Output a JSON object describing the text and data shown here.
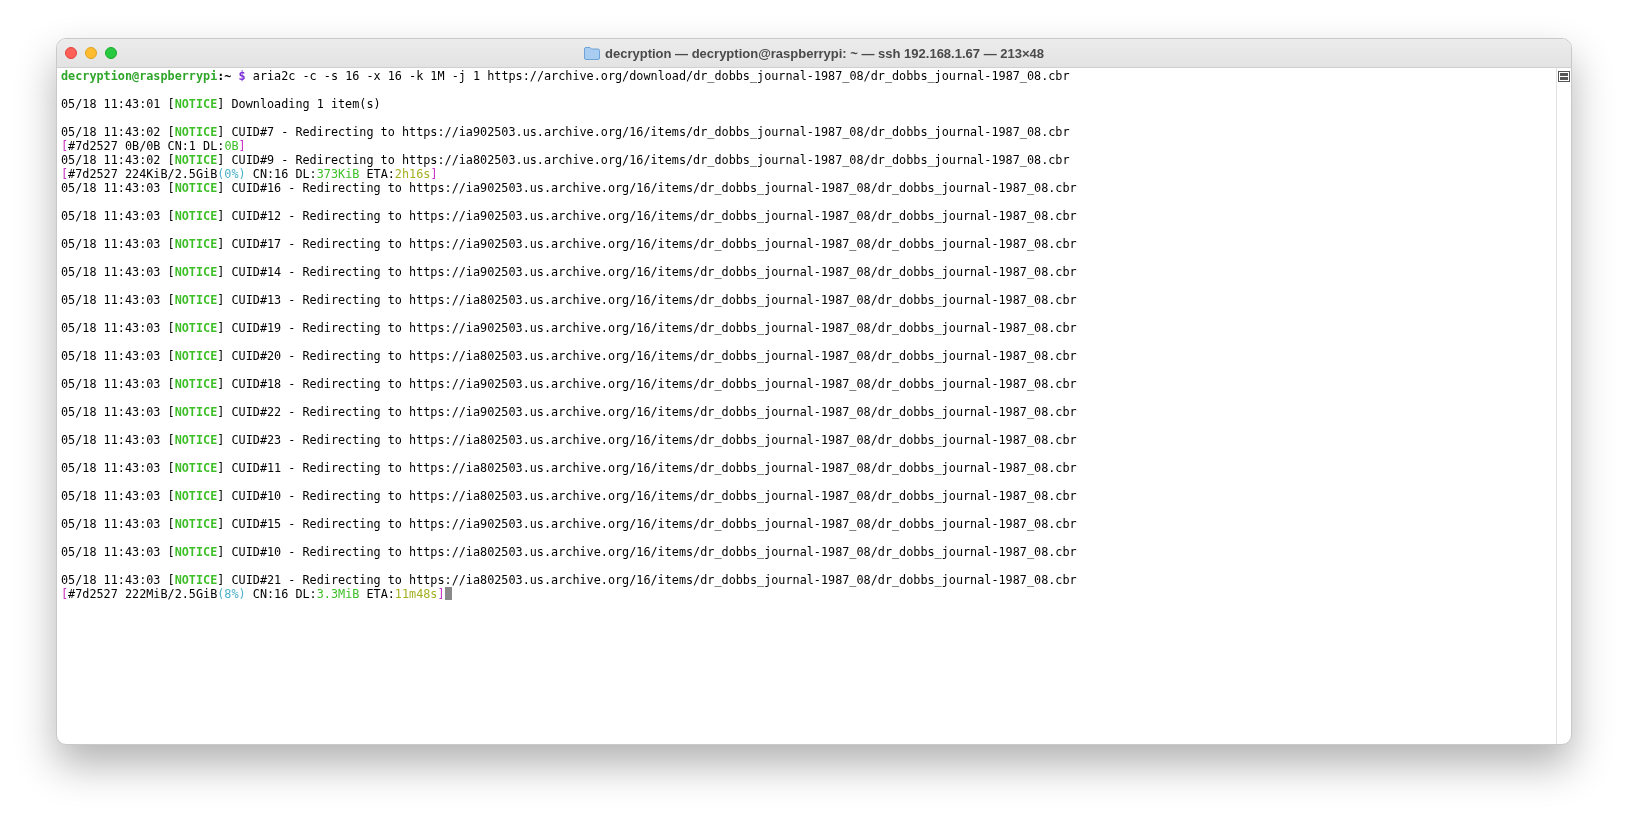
{
  "window": {
    "title": "decryption — decryption@raspberrypi: ~ — ssh 192.168.1.67 — 213×48"
  },
  "terminal": {
    "lines": [
      {
        "blank_before": false,
        "cursor": false,
        "segments": [
          {
            "text": "decryption@raspberrypi",
            "color": "#2fa52a",
            "bold": true
          },
          {
            "text": ":~",
            "color": "#000000",
            "bold": true
          },
          {
            "text": " $ ",
            "color": "#7a2fd6",
            "bold": true
          },
          {
            "text": "aria2c -c -s 16 -x 16 -k 1M -j 1 https://archive.org/download/dr_dobbs_journal-1987_08/dr_dobbs_journal-1987_08.cbr",
            "color": "#000000",
            "bold": false
          }
        ]
      },
      {
        "blank_before": true,
        "cursor": false,
        "segments": [
          {
            "text": "05/18 11:43:01 [",
            "color": "#000000",
            "bold": false
          },
          {
            "text": "NOTICE",
            "color": "#3cbf26",
            "bold": true
          },
          {
            "text": "] Downloading 1 item(s)",
            "color": "#000000",
            "bold": false
          }
        ]
      },
      {
        "blank_before": true,
        "cursor": false,
        "segments": [
          {
            "text": "05/18 11:43:02 [",
            "color": "#000000",
            "bold": false
          },
          {
            "text": "NOTICE",
            "color": "#3cbf26",
            "bold": true
          },
          {
            "text": "] CUID#7 - Redirecting to https://ia902503.us.archive.org/16/items/dr_dobbs_journal-1987_08/dr_dobbs_journal-1987_08.cbr",
            "color": "#000000",
            "bold": false
          }
        ]
      },
      {
        "blank_before": false,
        "cursor": false,
        "segments": [
          {
            "text": "[",
            "color": "#c62fc6",
            "bold": false
          },
          {
            "text": "#7d2527 0B/0B CN:1 DL:",
            "color": "#000000",
            "bold": false
          },
          {
            "text": "0B",
            "color": "#3cbf26",
            "bold": false
          },
          {
            "text": "]",
            "color": "#c62fc6",
            "bold": false
          }
        ]
      },
      {
        "blank_before": false,
        "cursor": false,
        "segments": [
          {
            "text": "05/18 11:43:02 [",
            "color": "#000000",
            "bold": false
          },
          {
            "text": "NOTICE",
            "color": "#3cbf26",
            "bold": true
          },
          {
            "text": "] CUID#9 - Redirecting to https://ia802503.us.archive.org/16/items/dr_dobbs_journal-1987_08/dr_dobbs_journal-1987_08.cbr",
            "color": "#000000",
            "bold": false
          }
        ]
      },
      {
        "blank_before": false,
        "cursor": false,
        "segments": [
          {
            "text": "[",
            "color": "#c62fc6",
            "bold": false
          },
          {
            "text": "#7d2527 224KiB/2.5GiB",
            "color": "#000000",
            "bold": false
          },
          {
            "text": "(0%)",
            "color": "#4ab0c8",
            "bold": false
          },
          {
            "text": " CN:16 DL:",
            "color": "#000000",
            "bold": false
          },
          {
            "text": "373KiB",
            "color": "#3cbf26",
            "bold": false
          },
          {
            "text": " ETA:",
            "color": "#000000",
            "bold": false
          },
          {
            "text": "2h16s",
            "color": "#a4b020",
            "bold": false
          },
          {
            "text": "]",
            "color": "#c62fc6",
            "bold": false
          }
        ]
      },
      {
        "blank_before": false,
        "cursor": false,
        "segments": [
          {
            "text": "05/18 11:43:03 [",
            "color": "#000000",
            "bold": false
          },
          {
            "text": "NOTICE",
            "color": "#3cbf26",
            "bold": true
          },
          {
            "text": "] CUID#16 - Redirecting to https://ia902503.us.archive.org/16/items/dr_dobbs_journal-1987_08/dr_dobbs_journal-1987_08.cbr",
            "color": "#000000",
            "bold": false
          }
        ]
      },
      {
        "blank_before": true,
        "cursor": false,
        "segments": [
          {
            "text": "05/18 11:43:03 [",
            "color": "#000000",
            "bold": false
          },
          {
            "text": "NOTICE",
            "color": "#3cbf26",
            "bold": true
          },
          {
            "text": "] CUID#12 - Redirecting to https://ia902503.us.archive.org/16/items/dr_dobbs_journal-1987_08/dr_dobbs_journal-1987_08.cbr",
            "color": "#000000",
            "bold": false
          }
        ]
      },
      {
        "blank_before": true,
        "cursor": false,
        "segments": [
          {
            "text": "05/18 11:43:03 [",
            "color": "#000000",
            "bold": false
          },
          {
            "text": "NOTICE",
            "color": "#3cbf26",
            "bold": true
          },
          {
            "text": "] CUID#17 - Redirecting to https://ia902503.us.archive.org/16/items/dr_dobbs_journal-1987_08/dr_dobbs_journal-1987_08.cbr",
            "color": "#000000",
            "bold": false
          }
        ]
      },
      {
        "blank_before": true,
        "cursor": false,
        "segments": [
          {
            "text": "05/18 11:43:03 [",
            "color": "#000000",
            "bold": false
          },
          {
            "text": "NOTICE",
            "color": "#3cbf26",
            "bold": true
          },
          {
            "text": "] CUID#14 - Redirecting to https://ia902503.us.archive.org/16/items/dr_dobbs_journal-1987_08/dr_dobbs_journal-1987_08.cbr",
            "color": "#000000",
            "bold": false
          }
        ]
      },
      {
        "blank_before": true,
        "cursor": false,
        "segments": [
          {
            "text": "05/18 11:43:03 [",
            "color": "#000000",
            "bold": false
          },
          {
            "text": "NOTICE",
            "color": "#3cbf26",
            "bold": true
          },
          {
            "text": "] CUID#13 - Redirecting to https://ia802503.us.archive.org/16/items/dr_dobbs_journal-1987_08/dr_dobbs_journal-1987_08.cbr",
            "color": "#000000",
            "bold": false
          }
        ]
      },
      {
        "blank_before": true,
        "cursor": false,
        "segments": [
          {
            "text": "05/18 11:43:03 [",
            "color": "#000000",
            "bold": false
          },
          {
            "text": "NOTICE",
            "color": "#3cbf26",
            "bold": true
          },
          {
            "text": "] CUID#19 - Redirecting to https://ia902503.us.archive.org/16/items/dr_dobbs_journal-1987_08/dr_dobbs_journal-1987_08.cbr",
            "color": "#000000",
            "bold": false
          }
        ]
      },
      {
        "blank_before": true,
        "cursor": false,
        "segments": [
          {
            "text": "05/18 11:43:03 [",
            "color": "#000000",
            "bold": false
          },
          {
            "text": "NOTICE",
            "color": "#3cbf26",
            "bold": true
          },
          {
            "text": "] CUID#20 - Redirecting to https://ia802503.us.archive.org/16/items/dr_dobbs_journal-1987_08/dr_dobbs_journal-1987_08.cbr",
            "color": "#000000",
            "bold": false
          }
        ]
      },
      {
        "blank_before": true,
        "cursor": false,
        "segments": [
          {
            "text": "05/18 11:43:03 [",
            "color": "#000000",
            "bold": false
          },
          {
            "text": "NOTICE",
            "color": "#3cbf26",
            "bold": true
          },
          {
            "text": "] CUID#18 - Redirecting to https://ia902503.us.archive.org/16/items/dr_dobbs_journal-1987_08/dr_dobbs_journal-1987_08.cbr",
            "color": "#000000",
            "bold": false
          }
        ]
      },
      {
        "blank_before": true,
        "cursor": false,
        "segments": [
          {
            "text": "05/18 11:43:03 [",
            "color": "#000000",
            "bold": false
          },
          {
            "text": "NOTICE",
            "color": "#3cbf26",
            "bold": true
          },
          {
            "text": "] CUID#22 - Redirecting to https://ia902503.us.archive.org/16/items/dr_dobbs_journal-1987_08/dr_dobbs_journal-1987_08.cbr",
            "color": "#000000",
            "bold": false
          }
        ]
      },
      {
        "blank_before": true,
        "cursor": false,
        "segments": [
          {
            "text": "05/18 11:43:03 [",
            "color": "#000000",
            "bold": false
          },
          {
            "text": "NOTICE",
            "color": "#3cbf26",
            "bold": true
          },
          {
            "text": "] CUID#23 - Redirecting to https://ia802503.us.archive.org/16/items/dr_dobbs_journal-1987_08/dr_dobbs_journal-1987_08.cbr",
            "color": "#000000",
            "bold": false
          }
        ]
      },
      {
        "blank_before": true,
        "cursor": false,
        "segments": [
          {
            "text": "05/18 11:43:03 [",
            "color": "#000000",
            "bold": false
          },
          {
            "text": "NOTICE",
            "color": "#3cbf26",
            "bold": true
          },
          {
            "text": "] CUID#11 - Redirecting to https://ia802503.us.archive.org/16/items/dr_dobbs_journal-1987_08/dr_dobbs_journal-1987_08.cbr",
            "color": "#000000",
            "bold": false
          }
        ]
      },
      {
        "blank_before": true,
        "cursor": false,
        "segments": [
          {
            "text": "05/18 11:43:03 [",
            "color": "#000000",
            "bold": false
          },
          {
            "text": "NOTICE",
            "color": "#3cbf26",
            "bold": true
          },
          {
            "text": "] CUID#10 - Redirecting to https://ia802503.us.archive.org/16/items/dr_dobbs_journal-1987_08/dr_dobbs_journal-1987_08.cbr",
            "color": "#000000",
            "bold": false
          }
        ]
      },
      {
        "blank_before": true,
        "cursor": false,
        "segments": [
          {
            "text": "05/18 11:43:03 [",
            "color": "#000000",
            "bold": false
          },
          {
            "text": "NOTICE",
            "color": "#3cbf26",
            "bold": true
          },
          {
            "text": "] CUID#15 - Redirecting to https://ia902503.us.archive.org/16/items/dr_dobbs_journal-1987_08/dr_dobbs_journal-1987_08.cbr",
            "color": "#000000",
            "bold": false
          }
        ]
      },
      {
        "blank_before": true,
        "cursor": false,
        "segments": [
          {
            "text": "05/18 11:43:03 [",
            "color": "#000000",
            "bold": false
          },
          {
            "text": "NOTICE",
            "color": "#3cbf26",
            "bold": true
          },
          {
            "text": "] CUID#10 - Redirecting to https://ia802503.us.archive.org/16/items/dr_dobbs_journal-1987_08/dr_dobbs_journal-1987_08.cbr",
            "color": "#000000",
            "bold": false
          }
        ]
      },
      {
        "blank_before": true,
        "cursor": false,
        "segments": [
          {
            "text": "05/18 11:43:03 [",
            "color": "#000000",
            "bold": false
          },
          {
            "text": "NOTICE",
            "color": "#3cbf26",
            "bold": true
          },
          {
            "text": "] CUID#21 - Redirecting to https://ia802503.us.archive.org/16/items/dr_dobbs_journal-1987_08/dr_dobbs_journal-1987_08.cbr",
            "color": "#000000",
            "bold": false
          }
        ]
      },
      {
        "blank_before": false,
        "cursor": true,
        "segments": [
          {
            "text": "[",
            "color": "#c62fc6",
            "bold": false
          },
          {
            "text": "#7d2527 222MiB/2.5GiB",
            "color": "#000000",
            "bold": false
          },
          {
            "text": "(8%)",
            "color": "#4ab0c8",
            "bold": false
          },
          {
            "text": " CN:16 DL:",
            "color": "#000000",
            "bold": false
          },
          {
            "text": "3.3MiB",
            "color": "#3cbf26",
            "bold": false
          },
          {
            "text": " ETA:",
            "color": "#000000",
            "bold": false
          },
          {
            "text": "11m48s",
            "color": "#a4b020",
            "bold": false
          },
          {
            "text": "]",
            "color": "#c62fc6",
            "bold": false
          }
        ]
      }
    ]
  }
}
